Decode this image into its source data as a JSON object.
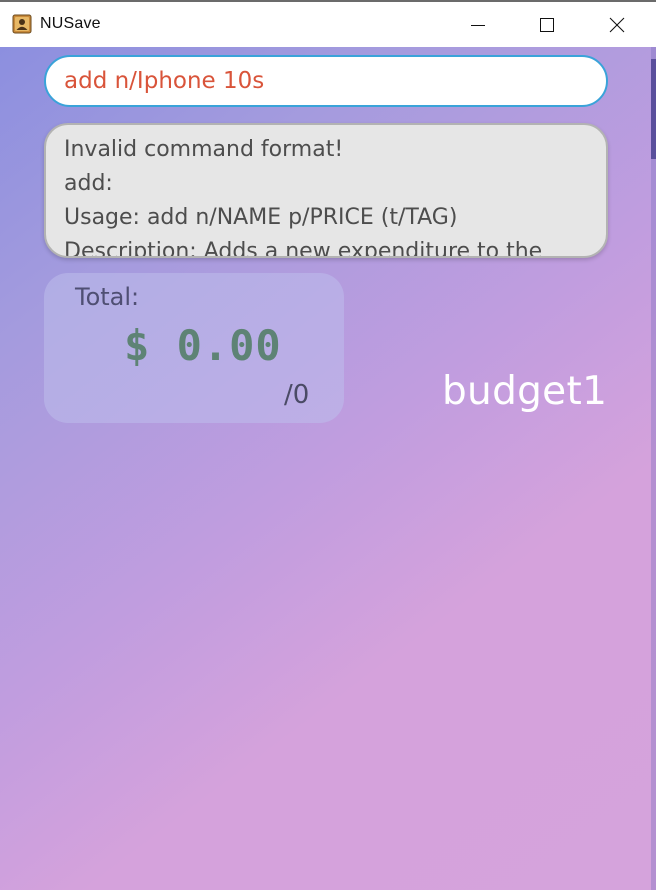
{
  "window": {
    "title": "NUSave",
    "icon": "contacts-book-icon"
  },
  "command": {
    "value": "add n/Iphone 10s"
  },
  "result": {
    "text": "Invalid command format!\nadd:\nUsage: add n/NAME p/PRICE (t/TAG)\nDescription: Adds a new expenditure to the"
  },
  "summary": {
    "total_label": "Total:",
    "amount": "$ 0.00",
    "limit": "/0"
  },
  "budget": {
    "name": "budget1"
  },
  "colors": {
    "accent_border": "#3aa3d9",
    "command_text": "#d9543a",
    "amount_text": "#5e8375",
    "gradient_start": "#8c8fdf",
    "gradient_end": "#d5a3dc"
  }
}
